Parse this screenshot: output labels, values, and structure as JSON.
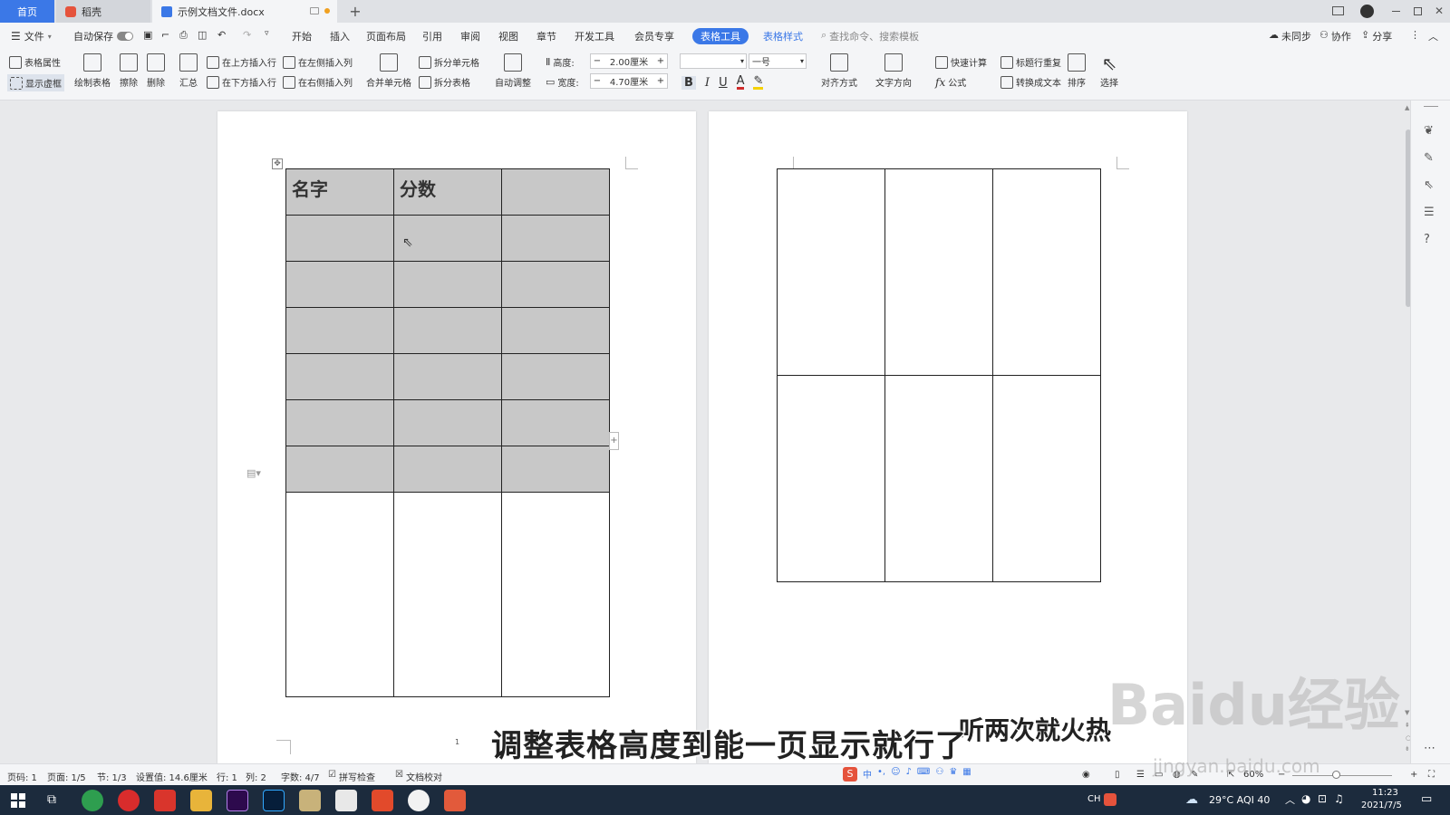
{
  "titlebar": {
    "tabs": [
      {
        "label": "首页"
      },
      {
        "label": "稻壳"
      },
      {
        "label": "示例文档文件.docx"
      }
    ],
    "new_tab": "+"
  },
  "menubar": {
    "file": "文件",
    "autosave": "自动保存",
    "items": [
      "开始",
      "插入",
      "页面布局",
      "引用",
      "审阅",
      "视图",
      "章节",
      "开发工具",
      "会员专享"
    ],
    "table_tools": "表格工具",
    "table_style": "表格样式",
    "search_placeholder": "查找命令、搜索模板",
    "sync": "未同步",
    "collab": "协作",
    "share": "分享"
  },
  "ribbon": {
    "table_props": "表格属性",
    "show_gridlines": "显示虚框",
    "draw_table": "绘制表格",
    "erase": "擦除",
    "delete": "删除",
    "summary": "汇总",
    "insert_above": "在上方插入行",
    "insert_below": "在下方插入行",
    "insert_left": "在左侧插入列",
    "insert_right": "在右侧插入列",
    "merge_cells": "合并单元格",
    "split_cells": "拆分单元格",
    "split_table": "拆分表格",
    "auto_adjust": "自动调整",
    "height_label": "高度:",
    "height_value": "2.00厘米",
    "width_label": "宽度:",
    "width_value": "4.70厘米",
    "font_size": "一号",
    "align": "对齐方式",
    "text_direction": "文字方向",
    "quick_calc": "快速计算",
    "formula": "公式",
    "repeat_header": "标题行重复",
    "convert_text": "转换成文本",
    "sort": "排序",
    "select": "选择",
    "bold": "B",
    "italic": "I",
    "underline": "U",
    "font_color": "A"
  },
  "document": {
    "table_headers": [
      "名字",
      "分数",
      ""
    ],
    "page_number": "1"
  },
  "statusbar": {
    "page_num": "页码: 1",
    "page_total": "页面: 1/5",
    "section": "节: 1/3",
    "setting": "设置值: 14.6厘米",
    "row": "行: 1",
    "col": "列: 2",
    "wordcount": "字数: 4/7",
    "spellcheck": "拼写检查",
    "proofread": "文档校对",
    "zoom": "60%"
  },
  "taskbar": {
    "lang": "CH",
    "weather": "29°C  AQI 40",
    "time": "11:23",
    "date": "2021/7/5"
  },
  "overlay": {
    "subtitle": "调整表格高度到能一页显示就行了",
    "subtitle2": "听两次就火热",
    "watermark": "Baidu经验",
    "watermark_url": "jingyan.baidu.com"
  },
  "colors": {
    "accent": "#3b78e7",
    "shaded_cell": "#c8c8c8",
    "taskbar": "#1c2b3d"
  }
}
